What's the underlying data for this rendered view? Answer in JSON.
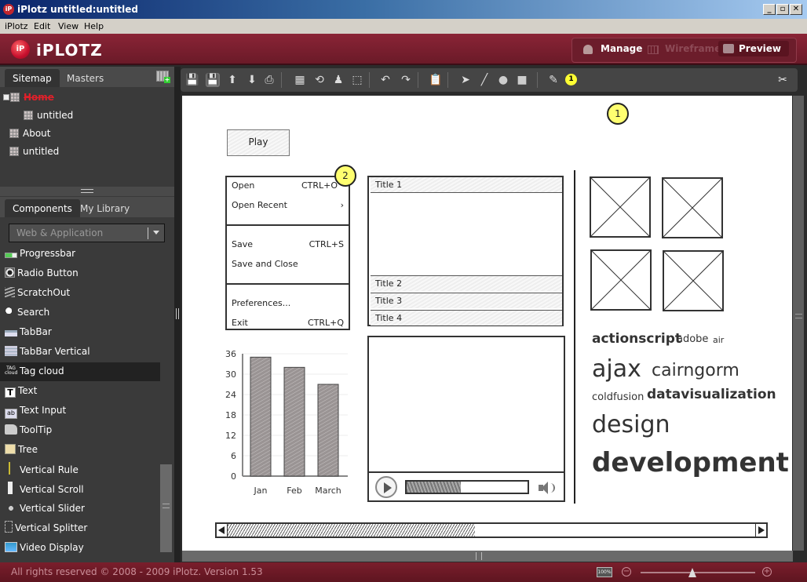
{
  "window": {
    "title": "iPlotz  untitled:untitled",
    "controls": [
      "_",
      "▫",
      "✕"
    ]
  },
  "menubar": [
    "iPlotz",
    "Edit",
    "View",
    "Help"
  ],
  "app": {
    "logo_badge": "iP",
    "logo_text": "iPLOTZ",
    "modes": [
      {
        "label": "Manage",
        "icon": "user-icon",
        "state": "normal"
      },
      {
        "label": "Wireframe",
        "icon": "grid-icon",
        "state": "disabled"
      },
      {
        "label": "Preview",
        "icon": "comment-icon",
        "state": "active"
      }
    ],
    "accent_color": "#6c1d2b"
  },
  "sitemap_panel": {
    "tabs": [
      "Sitemap",
      "Masters"
    ],
    "active_tab": "Sitemap",
    "tree": [
      {
        "label": "Home",
        "level": 0,
        "expanded": true,
        "highlighted": true
      },
      {
        "label": "untitled",
        "level": 1
      },
      {
        "label": "About",
        "level": 0
      },
      {
        "label": "untitled",
        "level": 0
      }
    ]
  },
  "components_panel": {
    "tabs": [
      "Components",
      "My Library"
    ],
    "active_tab": "Components",
    "category_select": "Web & Application",
    "items": [
      {
        "label": "Progressbar",
        "icon": "progressbar-icon"
      },
      {
        "label": "Radio Button",
        "icon": "radio-icon"
      },
      {
        "label": "ScratchOut",
        "icon": "scratchout-icon"
      },
      {
        "label": "Search",
        "icon": "search-icon"
      },
      {
        "label": "TabBar",
        "icon": "tabbar-icon"
      },
      {
        "label": "TabBar Vertical",
        "icon": "tabbar-vertical-icon"
      },
      {
        "label": "Tag cloud",
        "icon": "tag-cloud-icon",
        "selected": true
      },
      {
        "label": "Text",
        "icon": "text-icon"
      },
      {
        "label": "Text Input",
        "icon": "text-input-icon"
      },
      {
        "label": "ToolTip",
        "icon": "tooltip-icon"
      },
      {
        "label": "Tree",
        "icon": "tree-icon"
      },
      {
        "label": "Vertical Rule",
        "icon": "vertical-rule-icon"
      },
      {
        "label": "Vertical Scroll",
        "icon": "vertical-scroll-icon"
      },
      {
        "label": "Vertical Slider",
        "icon": "vertical-slider-icon"
      },
      {
        "label": "Vertical Splitter",
        "icon": "vertical-splitter-icon"
      },
      {
        "label": "Video Display",
        "icon": "video-display-icon"
      }
    ],
    "tag_cloud_icon_text": [
      "TAG",
      "cloud"
    ]
  },
  "toolbar": {
    "buttons": [
      "save-icon",
      "save-version-icon",
      "upload-icon",
      "download-icon",
      "print-icon",
      "grid-icon",
      "history-icon",
      "user-move-icon",
      "selection-icon",
      "undo-icon",
      "redo-icon",
      "paste-icon",
      "pointer-icon",
      "line-icon",
      "circle-icon",
      "rectangle-icon",
      "notes-icon"
    ],
    "notes_count": "1",
    "settings_icon": "tools-icon"
  },
  "wireframe": {
    "annotation_1": "1",
    "annotation_2": "2",
    "play_button": "Play",
    "menu": {
      "groups": [
        [
          {
            "label": "Open",
            "shortcut": "CTRL+O"
          },
          {
            "label": "Open Recent",
            "shortcut": "›"
          }
        ],
        [
          {
            "label": "Save",
            "shortcut": "CTRL+S"
          },
          {
            "label": "Save and Close",
            "shortcut": ""
          }
        ],
        [
          {
            "label": "Preferences...",
            "shortcut": ""
          },
          {
            "label": "Exit",
            "shortcut": "CTRL+Q"
          }
        ]
      ]
    },
    "accordion": {
      "panels": [
        "Title 1",
        "Title 2",
        "Title 3",
        "Title 4"
      ],
      "expanded": "Title 1"
    },
    "video_player": {
      "progress": 0.45
    },
    "image_placeholders": 4,
    "tag_cloud": [
      {
        "text": "actionscript",
        "weight": 3
      },
      {
        "text": "adobe",
        "weight": 1
      },
      {
        "text": "air",
        "weight": 0
      },
      {
        "text": "ajax",
        "weight": 5
      },
      {
        "text": "cairngorm",
        "weight": 4
      },
      {
        "text": "coldfusion",
        "weight": 1
      },
      {
        "text": "datavisualization",
        "weight": 3
      },
      {
        "text": "design",
        "weight": 5
      },
      {
        "text": "development",
        "weight": 6
      }
    ],
    "hscroll_progress": 0.45
  },
  "chart_data": {
    "type": "bar",
    "categories": [
      "Jan",
      "Feb",
      "March"
    ],
    "values": [
      35,
      32,
      27
    ],
    "title": "",
    "xlabel": "",
    "ylabel": "",
    "ylim": [
      0,
      36
    ],
    "yticks": [
      "0",
      "6",
      "12",
      "18",
      "24",
      "30",
      "36"
    ],
    "grid": true
  },
  "statusbar": {
    "copyright": "All rights reserved © 2008 - 2009 iPlotz. Version 1.53",
    "zoom_label": "100%",
    "zoom_level": 0.45
  }
}
